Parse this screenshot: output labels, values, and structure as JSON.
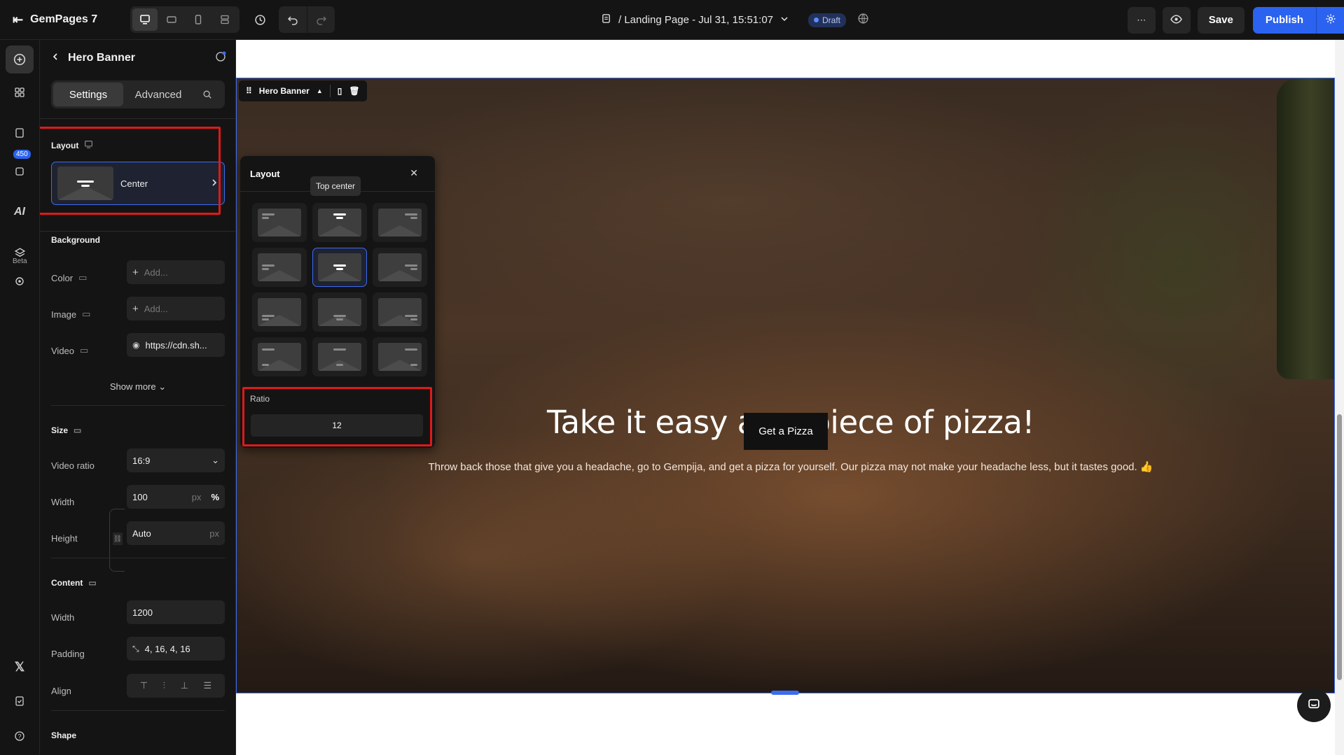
{
  "topbar": {
    "brand": "GemPages 7",
    "page_path": "/ Landing Page - Jul 31, 15:51:07",
    "status": "Draft",
    "save_label": "Save",
    "publish_label": "Publish"
  },
  "rail": {
    "badge_count": "450",
    "ai_label": "AI",
    "beta_label": "Beta"
  },
  "panel": {
    "title": "Hero Banner",
    "tabs": [
      "Settings",
      "Advanced"
    ],
    "layout": {
      "title": "Layout",
      "value": "Center"
    },
    "background": {
      "title": "Background",
      "color_label": "Color",
      "color_placeholder": "Add...",
      "image_label": "Image",
      "image_placeholder": "Add...",
      "video_label": "Video",
      "video_value": "https://cdn.sh...",
      "show_more": "Show more"
    },
    "size": {
      "title": "Size",
      "video_ratio_label": "Video ratio",
      "video_ratio_value": "16:9",
      "width_label": "Width",
      "width_value": "100",
      "width_unit_px": "px",
      "width_unit_pct": "%",
      "height_label": "Height",
      "height_value": "Auto",
      "height_unit": "px"
    },
    "content": {
      "title": "Content",
      "width_label": "Width",
      "width_value": "1200",
      "padding_label": "Padding",
      "padding_value": "4, 16, 4, 16",
      "align_label": "Align"
    },
    "shape": {
      "title": "Shape"
    }
  },
  "canvas": {
    "toolbar_label": "Hero Banner",
    "hero_title": "Take it easy as a piece of pizza!",
    "hero_subtitle": "Throw back those that give you a headache, go to Gempija, and get a pizza for yourself. Our pizza may not make your headache less, but it tastes good.  👍",
    "hero_button": "Get a Pizza"
  },
  "popover": {
    "title": "Layout",
    "tooltip": "Top center",
    "ratio_label": "Ratio",
    "ratio_value": "12"
  }
}
